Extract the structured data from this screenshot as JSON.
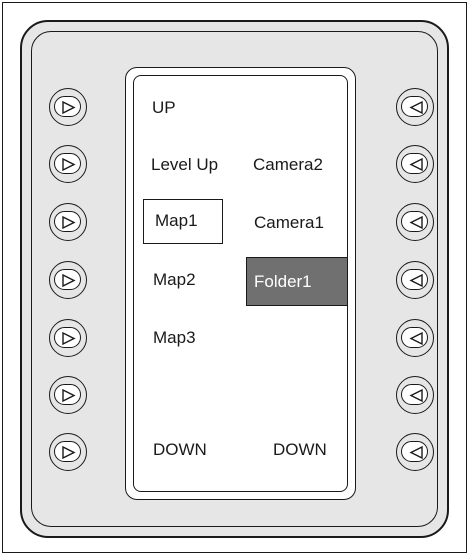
{
  "colors": {
    "device_body": "#e6e6e6",
    "outline": "#1a1a1a",
    "screen": "#ffffff",
    "highlight": "#707070",
    "highlight_text": "#ffffff"
  },
  "left_keys": {
    "icon": "triangle-right-icon",
    "count": 7
  },
  "right_keys": {
    "icon": "triangle-left-icon",
    "count": 7
  },
  "screen": {
    "left_column": {
      "row1": "UP",
      "row2": "Level Up",
      "row3": "Map1",
      "row4": "Map2",
      "row5": "Map3",
      "row7": "DOWN"
    },
    "right_column": {
      "row2": "Camera2",
      "row3": "Camera1",
      "row4": "Folder1",
      "row7": "DOWN"
    },
    "selected_item": "Map1",
    "highlighted_item": "Folder1"
  }
}
